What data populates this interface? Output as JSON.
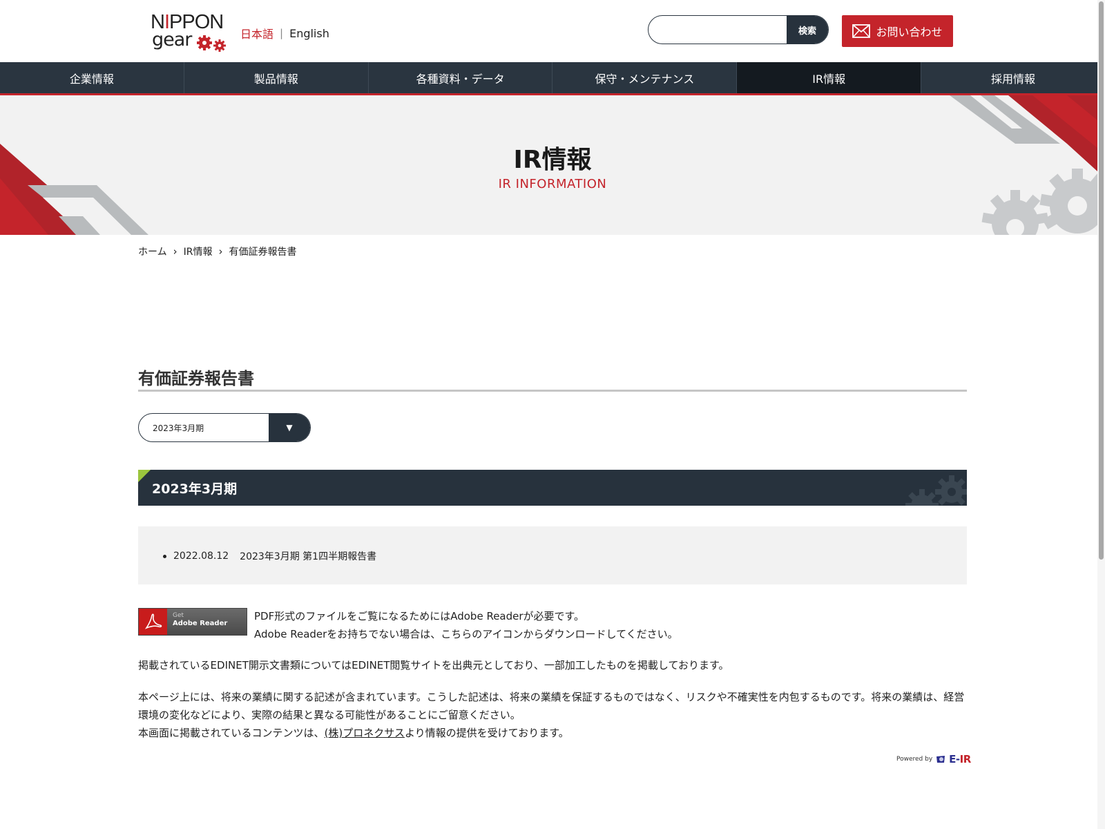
{
  "header": {
    "logo_top": "NIPPON",
    "logo_bottom": "gear",
    "lang_ja": "日本語",
    "lang_sep": "|",
    "lang_en": "English",
    "search_placeholder": "",
    "search_button": "検索",
    "contact_label": "お問い合わせ"
  },
  "nav": {
    "items": [
      {
        "label": "企業情報"
      },
      {
        "label": "製品情報"
      },
      {
        "label": "各種資料・データ"
      },
      {
        "label": "保守・メンテナンス"
      },
      {
        "label": "IR情報"
      },
      {
        "label": "採用情報"
      }
    ]
  },
  "hero": {
    "title": "IR情報",
    "subtitle": "IR INFORMATION"
  },
  "breadcrumb": {
    "items": [
      "ホーム",
      "IR情報",
      "有価証券報告書"
    ],
    "separator": "›"
  },
  "main": {
    "section_title": "有価証券報告書",
    "period_select_value": "2023年3月期",
    "period_select_caret": "▼",
    "year_heading": "2023年3月期",
    "documents": [
      {
        "date": "2022.08.12",
        "title": "2023年3月期 第1四半期報告書"
      }
    ],
    "adobe_get": "Get",
    "adobe_reader": "Adobe Reader",
    "pdf_note_1": "PDF形式のファイルをご覧になるためにはAdobe Readerが必要です。",
    "pdf_note_2": "Adobe Readerをお持ちでない場合は、こちらのアイコンからダウンロードしてください。",
    "edinet_note": "掲載されているEDINET開示文書類についてはEDINET閲覧サイトを出典元としており、一部加工したものを掲載しております。",
    "disclaimer_1": "本ページ上には、将来の業績に関する記述が含まれています。こうした記述は、将来の業績を保証するものではなく、リスクや不確実性を内包するものです。将来の業績は、経営環境の変化などにより、実際の結果と異なる可能性があることにご留意ください。",
    "disclaimer_2_pre": "本画面に掲載されているコンテンツは、",
    "disclaimer_2_link": "(株)プロネクサス",
    "disclaimer_2_post": "より情報の提供を受けております。",
    "powered_by": "Powered by",
    "eir_e": "E-",
    "eir_r": "IR"
  },
  "colors": {
    "accent_red": "#c4242b",
    "nav_dark": "#2a3540",
    "nav_active": "#141a20",
    "green_corner": "#9bc53d"
  }
}
